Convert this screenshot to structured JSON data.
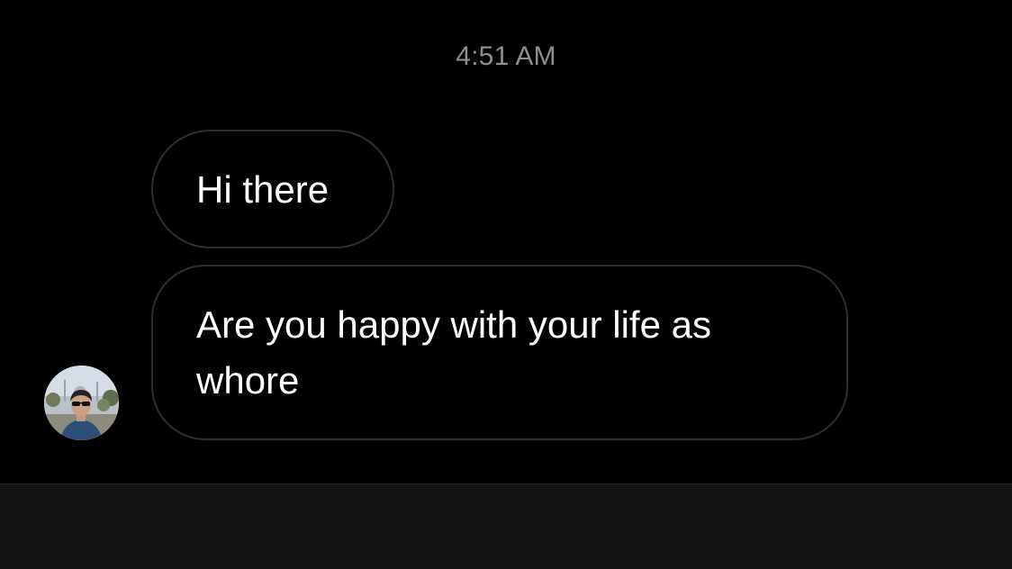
{
  "chat": {
    "timestamp": "4:51 AM",
    "messages": [
      {
        "text": "Hi there"
      },
      {
        "text": "Are you happy with your life as whore"
      }
    ]
  },
  "colors": {
    "background": "#000000",
    "bubble_border": "#2f2f2f",
    "timestamp_text": "#8e8e8e",
    "message_text": "#ffffff",
    "bottom_bar": "#141414"
  }
}
